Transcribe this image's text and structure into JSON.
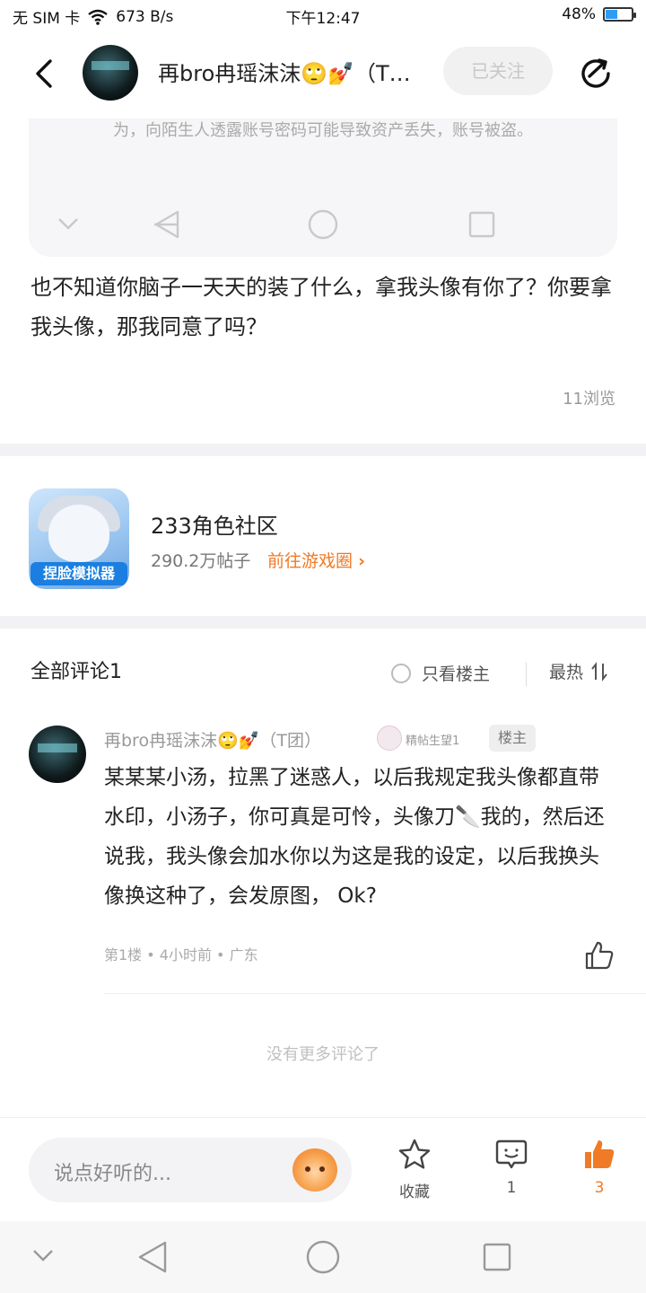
{
  "status_bar": {
    "left": "无 SIM 卡",
    "speed": "673 B/s",
    "time": "下午12:47",
    "battery": "48%",
    "battery_level": 0.48
  },
  "header": {
    "title": "再bro冉瑶沫沫🙄💅（T…",
    "follow_label": "已关注"
  },
  "embed": {
    "text": "为，向陌生人透露账号密码可能导致资产丢失，账号被盗。"
  },
  "post": {
    "text": "也不知道你脑子一天天的装了什么，拿我头像有你了？你要拿我头像，那我同意了吗？",
    "views": "11浏览"
  },
  "community": {
    "icon_badge": "捏脸模拟器",
    "name": "233角色社区",
    "posts": "290.2万帖子",
    "link": "前往游戏圈"
  },
  "comments": {
    "title": "全部评论1",
    "only_owner": "只看楼主",
    "sort": "最热",
    "list": [
      {
        "author": "再bro冉瑶沫沫🙄💅（T团）",
        "badge": "精帖生望1",
        "owner_tag": "楼主",
        "body": "某某某小汤，拉黑了迷惑人，以后我规定我头像都直带水印，小汤子，你可真是可怜，头像刀🔪我的，然后还说我，我头像会加水你以为这是我的设定，以后我换头像换这种了，会发原图， Ok?",
        "meta": "第1楼 • 4小时前 • 广东"
      }
    ],
    "no_more": "没有更多评论了"
  },
  "bottom_bar": {
    "input_placeholder": "说点好听的...",
    "favorite_label": "收藏",
    "comment_count": "1",
    "like_count": "3",
    "accent": "#f07a25"
  }
}
